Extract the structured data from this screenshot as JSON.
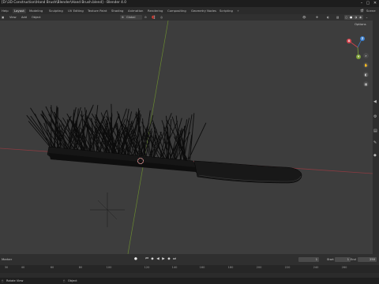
{
  "window": {
    "title": "[D:\\3D Construction\\Hand Brush\\Blender\\Hand Brush.blend] - Blender 4.0"
  },
  "menu": {
    "items": [
      "Help"
    ],
    "workspaces": [
      "Layout",
      "Modeling",
      "Sculpting",
      "UV Editing",
      "Texture Paint",
      "Shading",
      "Animation",
      "Rendering",
      "Compositing",
      "Geometry Nodes",
      "Scripting"
    ],
    "active_workspace": "Layout",
    "scene": "Scene"
  },
  "viewport_header": {
    "menus": [
      "View",
      "Add",
      "Object"
    ],
    "orientation": "Global",
    "options_label": "Options"
  },
  "gizmo": {
    "x_label": "X",
    "y_label": "Y",
    "z_label": "Z"
  },
  "timeline": {
    "marker_label": "Marker",
    "current_frame": "1",
    "start_label": "Start",
    "start_value": "1",
    "end_label": "End",
    "end_value": "250",
    "ruler_ticks": [
      "30",
      "40",
      "60",
      "80",
      "100",
      "120",
      "140",
      "160",
      "180",
      "200",
      "220",
      "240",
      "260"
    ]
  },
  "statusbar": {
    "left": "Rotate View",
    "middle": "Object"
  },
  "colors": {
    "x_axis": "#d4434d",
    "y_axis": "#7ea235",
    "z_axis": "#3d82d2",
    "accent": "#4772b3"
  }
}
